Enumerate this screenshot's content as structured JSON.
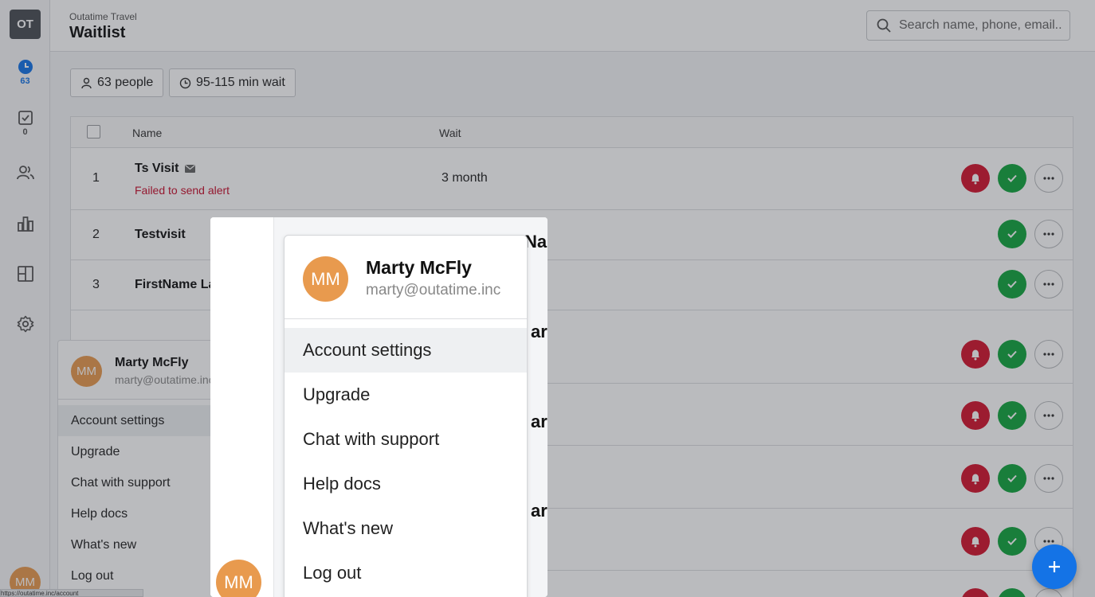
{
  "app": {
    "logo_initials": "OT",
    "org_name": "Outatime Travel",
    "page_title": "Waitlist"
  },
  "nav": {
    "waitlist_count": "63",
    "tasks_count": "0"
  },
  "search": {
    "placeholder": "Search name, phone, email.."
  },
  "summary": {
    "people": "63 people",
    "wait_range": "95-115 min wait"
  },
  "table": {
    "headers": {
      "name": "Name",
      "wait": "Wait"
    },
    "rows": [
      {
        "num": "1",
        "name": "Ts Visit",
        "error": "Failed to send alert",
        "wait": "3 month"
      },
      {
        "num": "2",
        "name": "Testvisit",
        "error": "",
        "wait": ""
      },
      {
        "num": "3",
        "name": "FirstName La",
        "error": "",
        "wait": ""
      }
    ]
  },
  "user": {
    "initials": "MM",
    "name": "Marty McFly",
    "email": "marty@outatime.inc"
  },
  "user_menu": {
    "items": [
      "Account settings",
      "Upgrade",
      "Chat with support",
      "Help docs",
      "What's new",
      "Log out"
    ]
  },
  "zoom_fragments": [
    "Na",
    "ar",
    "ar",
    "ar"
  ],
  "status_url": "https://outatime.inc/account",
  "colors": {
    "alert_red": "#d3162f",
    "confirm_green": "#12a53f",
    "primary_blue": "#1473e6",
    "avatar_orange": "#e89a4e"
  }
}
